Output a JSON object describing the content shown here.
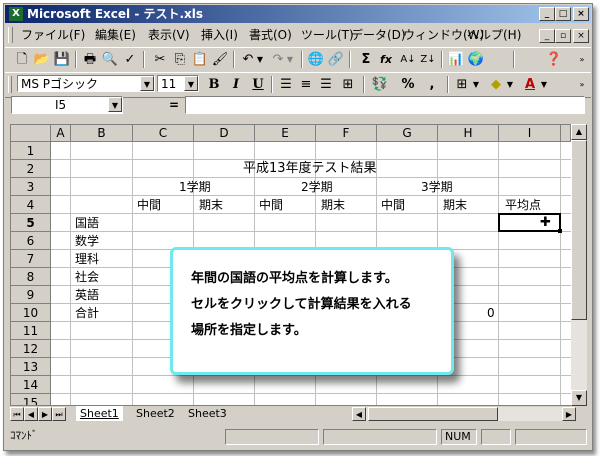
{
  "window": {
    "title": "Microsoft Excel - テスト.xls",
    "app_icon": "X"
  },
  "menu": [
    "ファイル(F)",
    "編集(E)",
    "表示(V)",
    "挿入(I)",
    "書式(O)",
    "ツール(T)",
    "データ(D)",
    "ウィンドウ(W)",
    "ヘルプ(H)"
  ],
  "format_toolbar": {
    "font_name": "MS Pゴシック",
    "font_size": "11",
    "bold": "B",
    "italic": "I",
    "underline": "U",
    "percent": "%",
    "comma": ","
  },
  "standard_toolbar": {
    "sigma": "Σ",
    "fx": "fx"
  },
  "formula_bar": {
    "name_box": "I5",
    "equals": "=",
    "value": ""
  },
  "columns": [
    "A",
    "B",
    "C",
    "D",
    "E",
    "F",
    "G",
    "H",
    "I"
  ],
  "rows": [
    "1",
    "2",
    "3",
    "4",
    "5",
    "6",
    "7",
    "8",
    "9",
    "10",
    "11",
    "12",
    "13",
    "14",
    "15"
  ],
  "sheet": {
    "title": "平成13年度テスト結果",
    "term1": "1学期",
    "term2": "2学期",
    "term3": "3学期",
    "mid1": "中間",
    "final1": "期末",
    "mid2": "中間",
    "final2": "期末",
    "mid3": "中間",
    "final3": "期末",
    "avg_header": "平均点",
    "subjects": [
      "国語",
      "数学",
      "理科",
      "社会",
      "英語",
      "合計"
    ],
    "h10_value": "0"
  },
  "callout": {
    "line1": "年間の国語の平均点を計算します。",
    "line2": "セルをクリックして計算結果を入れる",
    "line3": "場所を指定します。"
  },
  "sheet_tabs": [
    "Sheet1",
    "Sheet2",
    "Sheet3"
  ],
  "status": {
    "mode": "ｺﾏﾝﾄﾞ",
    "num": "NUM"
  },
  "colors": {
    "title_start": "#0a246a",
    "title_end": "#a6caf0",
    "callout_border": "#6fe8ee"
  }
}
